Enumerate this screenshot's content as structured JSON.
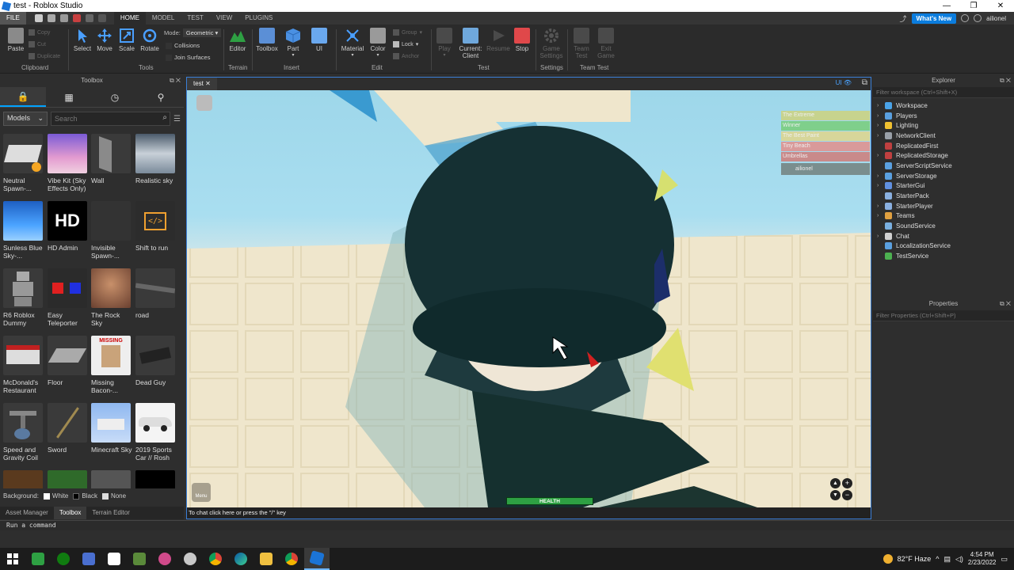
{
  "window": {
    "title": "test - Roblox Studio",
    "controls": [
      "—",
      "❐",
      "✕"
    ]
  },
  "menubar": {
    "file": "FILE",
    "tabs": [
      "HOME",
      "MODEL",
      "TEST",
      "VIEW",
      "PLUGINS"
    ],
    "active_tab": "HOME",
    "whats_new": "What's New",
    "user": "ailionel"
  },
  "ribbon": {
    "clipboard": {
      "paste": "Paste",
      "copy": "Copy",
      "cut": "Cut",
      "duplicate": "Duplicate",
      "group": "Clipboard"
    },
    "tools": {
      "select": "Select",
      "move": "Move",
      "scale": "Scale",
      "rotate": "Rotate",
      "mode_label": "Mode:",
      "mode_value": "Geometric",
      "collisions": "Collisions",
      "join_surfaces": "Join Surfaces",
      "group": "Tools"
    },
    "terrain": {
      "editor": "Editor",
      "group": "Terrain"
    },
    "insert": {
      "toolbox": "Toolbox",
      "part": "Part",
      "ui": "UI",
      "group": "Insert"
    },
    "edit": {
      "material": "Material",
      "color": "Color",
      "group_btn": "Group",
      "lock": "Lock",
      "anchor": "Anchor",
      "group": "Edit"
    },
    "test": {
      "play": "Play",
      "current_client": "Current:\nClient",
      "resume": "Resume",
      "stop": "Stop",
      "group": "Test"
    },
    "settings": {
      "game_settings": "Game Settings",
      "group": "Settings"
    },
    "team_test": {
      "team_test": "Team Test",
      "exit_game": "Exit Game",
      "group": "Team Test"
    }
  },
  "toolbox": {
    "title": "Toolbox",
    "category": "Models",
    "search_placeholder": "Search",
    "items": [
      {
        "name": "Neutral Spawn-..."
      },
      {
        "name": "Vibe Kit (Sky Effects Only)"
      },
      {
        "name": "Wall"
      },
      {
        "name": "Realistic sky"
      },
      {
        "name": "Sunless Blue Sky-..."
      },
      {
        "name": "HD Admin",
        "thumb_text": "HD"
      },
      {
        "name": "Invisible Spawn-..."
      },
      {
        "name": "Shift to run",
        "thumb_text": "</>"
      },
      {
        "name": "R6 Roblox Dummy"
      },
      {
        "name": "Easy Teleporter"
      },
      {
        "name": "The Rock Sky"
      },
      {
        "name": "road"
      },
      {
        "name": "McDonald's Restaurant"
      },
      {
        "name": "Floor"
      },
      {
        "name": "Missing Bacon-...",
        "thumb_text": "MISSING"
      },
      {
        "name": "Dead Guy"
      },
      {
        "name": "Speed and Gravity Coil"
      },
      {
        "name": "Sword"
      },
      {
        "name": "Minecraft Sky"
      },
      {
        "name": "2019 Sports Car // Rosh"
      }
    ],
    "background_label": "Background:",
    "bg_white": "White",
    "bg_black": "Black",
    "bg_none": "None",
    "bottom_tabs": [
      "Asset Manager",
      "Toolbox",
      "Terrain Editor"
    ]
  },
  "viewport": {
    "tab": "test",
    "ui_toggle": "UI",
    "leaderboard": [
      {
        "label": "The Extreme",
        "color": "#c7d38e"
      },
      {
        "label": "Winner",
        "color": "#7fcf8b"
      },
      {
        "label": "The Best Paint",
        "color": "#d7d69a"
      },
      {
        "label": "Tiny Beach",
        "color": "#d99a9a"
      },
      {
        "label": "Umbrellas",
        "color": "#c98a8a"
      }
    ],
    "player": "ailionel",
    "health": "HEALTH",
    "menu": "Menu",
    "chat_hint": "To chat click here or press the \"/\" key"
  },
  "explorer": {
    "title": "Explorer",
    "filter": "Filter workspace (Ctrl+Shift+X)",
    "nodes": [
      {
        "name": "Workspace",
        "color": "#4aa3e8",
        "expand": true
      },
      {
        "name": "Players",
        "color": "#5aa0e0",
        "expand": true
      },
      {
        "name": "Lighting",
        "color": "#f0c030",
        "expand": true
      },
      {
        "name": "NetworkClient",
        "color": "#9aa0a8",
        "expand": true
      },
      {
        "name": "ReplicatedFirst",
        "color": "#c04040",
        "expand": false
      },
      {
        "name": "ReplicatedStorage",
        "color": "#c04040",
        "expand": true
      },
      {
        "name": "ServerScriptService",
        "color": "#5aa0e0",
        "expand": false
      },
      {
        "name": "ServerStorage",
        "color": "#5aa0e0",
        "expand": true
      },
      {
        "name": "StarterGui",
        "color": "#6090e0",
        "expand": true
      },
      {
        "name": "StarterPack",
        "color": "#8ab0e0",
        "expand": false
      },
      {
        "name": "StarterPlayer",
        "color": "#8ab0e0",
        "expand": true
      },
      {
        "name": "Teams",
        "color": "#e0a040",
        "expand": true
      },
      {
        "name": "SoundService",
        "color": "#7ab0e0",
        "expand": false
      },
      {
        "name": "Chat",
        "color": "#d0d0d0",
        "expand": true
      },
      {
        "name": "LocalizationService",
        "color": "#5aa0e0",
        "expand": false
      },
      {
        "name": "TestService",
        "color": "#4cb050",
        "expand": false
      }
    ]
  },
  "properties": {
    "title": "Properties",
    "filter": "Filter Properties (Ctrl+Shift+P)"
  },
  "command_bar": {
    "placeholder": "Run a command"
  },
  "taskbar": {
    "weather": "82°F  Haze",
    "time": "4:54 PM",
    "date": "2/23/2022"
  }
}
